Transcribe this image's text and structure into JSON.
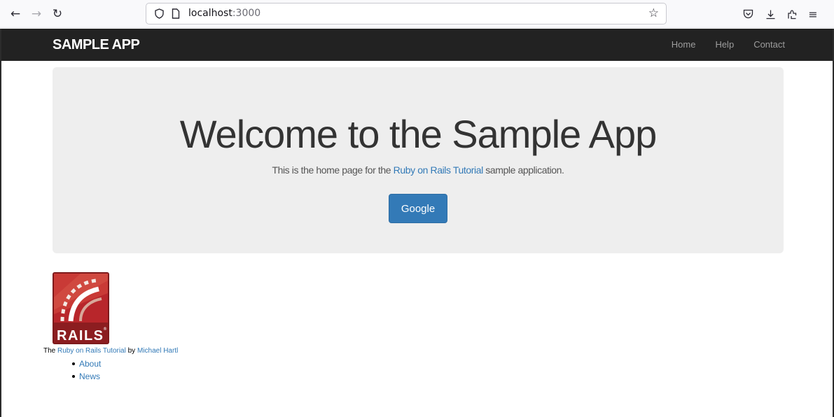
{
  "browser": {
    "back_icon": "arrow-left-icon",
    "forward_icon": "arrow-right-icon",
    "reload_icon": "reload-icon",
    "url_host": "localhost",
    "url_port": ":3000",
    "bookmark_icon": "star-outline-icon",
    "pocket_icon": "pocket-icon",
    "downloads_icon": "download-icon",
    "extensions_icon": "extensions-icon",
    "menu_icon": "hamburger-menu-icon"
  },
  "navbar": {
    "brand": "SAMPLE APP",
    "links": [
      "Home",
      "Help",
      "Contact"
    ],
    "background": "#222222"
  },
  "jumbotron": {
    "title": "Welcome to the Sample App",
    "subtitle_before": "This is the home page for the ",
    "subtitle_link": "Ruby on Rails Tutorial",
    "subtitle_after": " sample application.",
    "button_label": "Google",
    "button_color": "#337ab7"
  },
  "footer": {
    "logo_text": "RAILS",
    "text_prefix": "The ",
    "tutorial_link": "Ruby on Rails Tutorial",
    "text_middle": " by ",
    "author_link": "Michael Hartl",
    "list": [
      "About",
      "News"
    ]
  },
  "colors": {
    "link": "#337ab7",
    "jumbotron_bg": "#eeeeee"
  }
}
